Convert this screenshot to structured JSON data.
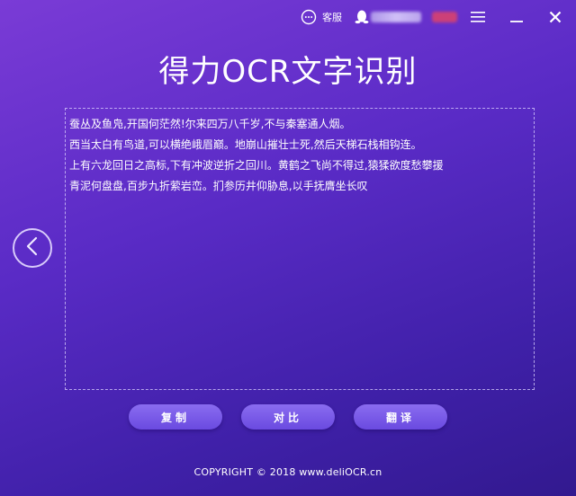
{
  "topbar": {
    "support_label": "客服",
    "icons": {
      "support": "chat-bubble-icon",
      "user": "qq-penguin-icon",
      "menu": "hamburger-menu-icon",
      "minimize": "minimize-icon",
      "close": "close-icon"
    }
  },
  "app": {
    "title": "得力OCR文字识别"
  },
  "result": {
    "lines": [
      "蚕丛及鱼凫,开国何茫然!尔来四万八千岁,不与秦塞通人烟。",
      "西当太白有鸟道,可以横绝峨眉巅。地崩山摧壮士死,然后天梯石栈相钩连。",
      "上有六龙回日之高标,下有冲波逆折之回川。黄鹤之飞尚不得过,猿猱欲度愁攀援",
      "青泥何盘盘,百步九折萦岩峦。扪参历井仰胁息,以手抚膺坐长叹"
    ]
  },
  "actions": {
    "copy_label": "复制",
    "compare_label": "对比",
    "translate_label": "翻译"
  },
  "footer": {
    "copyright": "COPYRIGHT © 2018  www.deliOCR.cn"
  },
  "colors": {
    "bg_top": "#7a3bd6",
    "bg_bottom": "#32198f",
    "button": "#7a5ce8",
    "text": "#ffffff"
  }
}
